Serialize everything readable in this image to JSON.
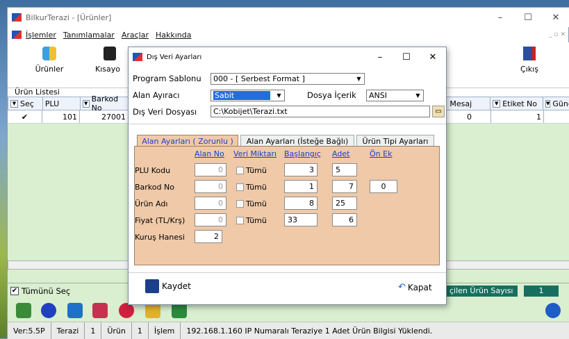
{
  "app": {
    "title": "BilkurTerazi - [Ürünler]",
    "window_controls": [
      "–",
      "☐",
      "✕"
    ],
    "menu": [
      "İşlemler",
      "Tanımlamalar",
      "Araçlar",
      "Hakkında"
    ]
  },
  "toolbar": {
    "urunler_label": "Ürünler",
    "kisayol_label": "Kısayo",
    "cikis_label": "Çıkış"
  },
  "grid": {
    "section_label": "Ürün Listesi",
    "columns": [
      "Seç",
      "PLU",
      "Barkod No",
      "Mesaj",
      "Etiket No",
      "Günc"
    ],
    "row": {
      "sec": "✔",
      "plu": "101",
      "barkod": "27001",
      "mesaj": "0",
      "etiket": "1"
    }
  },
  "footer": {
    "select_all": "Tümünü Seç",
    "selected_label": "çilen Ürün Sayısı",
    "selected_count": "1"
  },
  "status": {
    "ver": "Ver:5.5P",
    "terazi_label": "Terazi",
    "terazi_val": "1",
    "urun_label": "Ürün",
    "urun_val": "1",
    "islem_label": "İşlem",
    "message": "192.168.1.160 IP Numaralı Teraziye 1 Adet Ürün Bilgisi Yüklendi."
  },
  "dialog": {
    "title": "Dış Veri Ayarları",
    "program_sablonu_label": "Program Sablonu",
    "program_sablonu_value": "000 - [ Serbest Format ]",
    "alan_ayiraci_label": "Alan Ayıracı",
    "alan_ayiraci_value": "Sabit",
    "dosya_icerik_label": "Dosya İçerik",
    "dosya_icerik_value": "ANSI",
    "dis_veri_dosyasi_label": "Dış Veri Dosyası",
    "dis_veri_dosyasi_value": "C:\\Kobijet\\Terazi.txt",
    "tabs": [
      "Alan Ayarları ( Zorunlu )",
      "Alan Ayarları (İsteğe Bağlı)",
      "Ürün Tipi Ayarları"
    ],
    "headers": {
      "alan_no": "Alan No",
      "veri_miktari": "Veri Miktarı",
      "baslangic": "Başlangıç",
      "adet": "Adet",
      "on_ek": "Ön Ek"
    },
    "rows": [
      {
        "label": "PLU Kodu",
        "alan_no": "0",
        "tumu": "Tümü",
        "baslangic": "3",
        "adet": "5"
      },
      {
        "label": "Barkod No",
        "alan_no": "0",
        "tumu": "Tümü",
        "baslangic": "1",
        "adet": "7",
        "on_ek": "0"
      },
      {
        "label": "Ürün Adı",
        "alan_no": "0",
        "tumu": "Tümü",
        "baslangic": "8",
        "adet": "25"
      },
      {
        "label": "Fiyat (TL/Krş)",
        "alan_no": "0",
        "tumu": "Tümü",
        "baslangic": "33",
        "adet": "6"
      }
    ],
    "kurus_label": "Kuruş Hanesi",
    "kurus_value": "2",
    "kaydet": "Kaydet",
    "kapat": "Kapat"
  }
}
